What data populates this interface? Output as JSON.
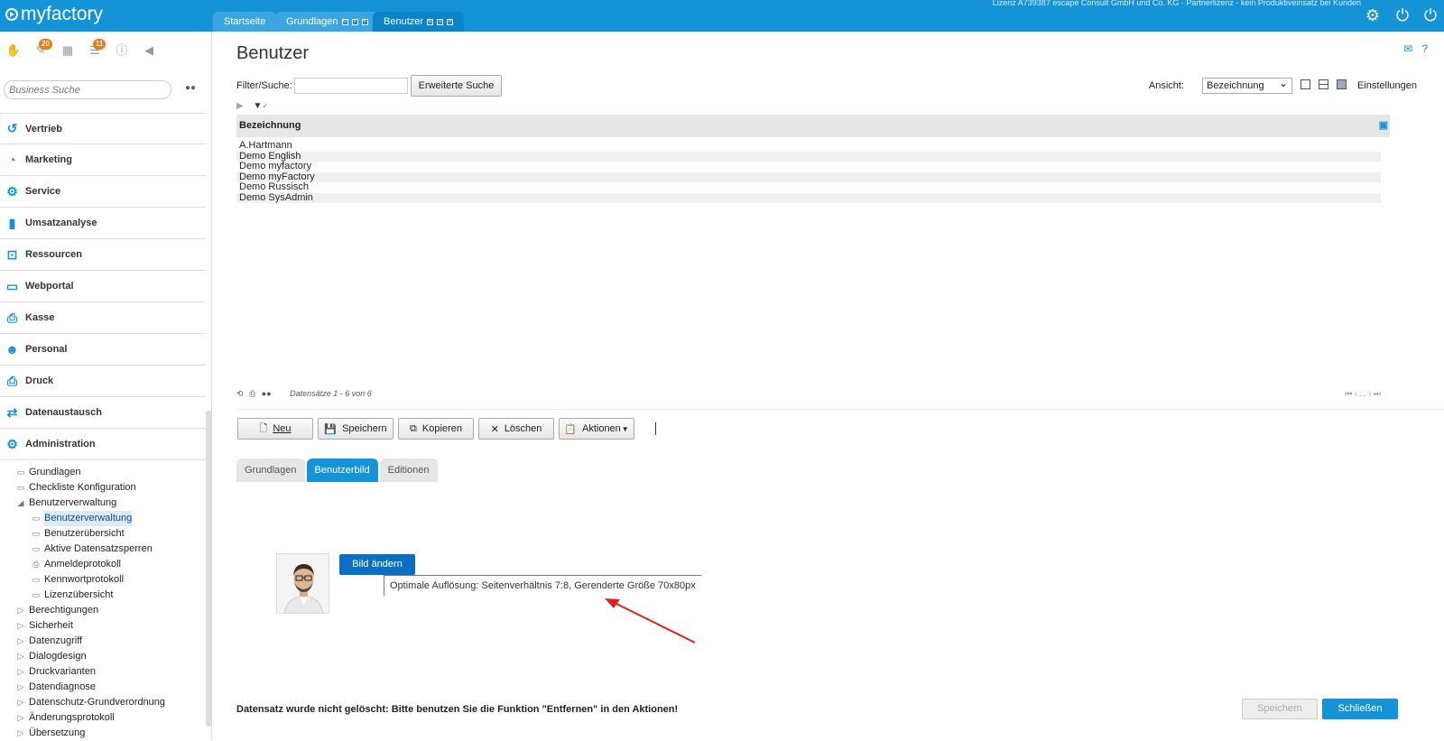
{
  "app": {
    "logo_text": "myfactory",
    "license": "Lizenz A739387 escape Consult GmbH und Co. KG - Partnerlizenz - kein Produktiveinsatz bei Kunden"
  },
  "tabs": [
    {
      "label": "Startseite"
    },
    {
      "label": "Grundlagen"
    },
    {
      "label": "Benutzer"
    }
  ],
  "sidebar": {
    "badges": {
      "tasks": "20",
      "notes": "11"
    },
    "search_placeholder": "Business Suche",
    "modules": [
      {
        "label": "Vertrieb",
        "icon": "vertrieb-icon"
      },
      {
        "label": "Marketing",
        "icon": "marketing-icon"
      },
      {
        "label": "Service",
        "icon": "service-icon"
      },
      {
        "label": "Umsatzanalyse",
        "icon": "chart-icon"
      },
      {
        "label": "Ressourcen",
        "icon": "ressourcen-icon"
      },
      {
        "label": "Webportal",
        "icon": "webportal-icon"
      },
      {
        "label": "Kasse",
        "icon": "kasse-icon"
      },
      {
        "label": "Personal",
        "icon": "personal-icon"
      },
      {
        "label": "Druck",
        "icon": "printer-icon"
      },
      {
        "label": "Datenaustausch",
        "icon": "exchange-icon"
      },
      {
        "label": "Administration",
        "icon": "gear-icon"
      }
    ],
    "tree": [
      {
        "label": "Grundlagen",
        "level": 1,
        "icon": "page"
      },
      {
        "label": "Checkliste Konfiguration",
        "level": 1,
        "icon": "page"
      },
      {
        "label": "Benutzerverwaltung",
        "level": 1,
        "icon": "open"
      },
      {
        "label": "Benutzerverwaltung",
        "level": 2,
        "icon": "page",
        "selected": true
      },
      {
        "label": "Benutzerübersicht",
        "level": 2,
        "icon": "page"
      },
      {
        "label": "Aktive Datensatzsperren",
        "level": 2,
        "icon": "page"
      },
      {
        "label": "Anmeldeprotokoll",
        "level": 2,
        "icon": "print"
      },
      {
        "label": "Kennwortprotokoll",
        "level": 2,
        "icon": "page"
      },
      {
        "label": "Lizenzübersicht",
        "level": 2,
        "icon": "page"
      },
      {
        "label": "Berechtigungen",
        "level": 1,
        "icon": "closed"
      },
      {
        "label": "Sicherheit",
        "level": 1,
        "icon": "closed"
      },
      {
        "label": "Datenzugriff",
        "level": 1,
        "icon": "closed"
      },
      {
        "label": "Dialogdesign",
        "level": 1,
        "icon": "closed"
      },
      {
        "label": "Druckvarianten",
        "level": 1,
        "icon": "closed"
      },
      {
        "label": "Datendiagnose",
        "level": 1,
        "icon": "closed"
      },
      {
        "label": "Datenschutz-Grundverordnung",
        "level": 1,
        "icon": "closed"
      },
      {
        "label": "Änderungsprotokoll",
        "level": 1,
        "icon": "closed"
      },
      {
        "label": "Übersetzung",
        "level": 1,
        "icon": "closed"
      }
    ]
  },
  "page": {
    "title": "Benutzer",
    "filter_label": "Filter/Suche:",
    "filter_value": "",
    "extended_search": "Erweiterte Suche",
    "view_label": "Ansicht:",
    "view_value": "Bezeichnung",
    "settings": "Einstellungen"
  },
  "grid": {
    "header": "Bezeichnung",
    "rows": [
      "A.Hartmann",
      "Demo English",
      "Demo myfactory",
      "Demo myFactory",
      "Demo Russisch",
      "Demo SysAdmin"
    ],
    "record_info": "Datensätze 1 - 6 von 6",
    "pager": "..."
  },
  "actions": {
    "neu": "Neu",
    "speichern": "Speichern",
    "kopieren": "Kopieren",
    "loeschen": "Löschen",
    "aktionen": "Aktionen"
  },
  "detail_tabs": [
    {
      "label": "Grundlagen"
    },
    {
      "label": "Benutzerbild"
    },
    {
      "label": "Editionen"
    }
  ],
  "picture": {
    "change_button": "Bild ändern",
    "hint": "Optimale Auflösung: Seitenverhältnis 7:8, Gerenderte Größe 70x80px"
  },
  "footer": {
    "status": "Datensatz wurde nicht gelöscht: Bitte benutzen Sie die Funktion \"Entfernen\" in den Aktionen!",
    "save": "Speichern",
    "close": "Schließen"
  },
  "colors": {
    "brand": "#1493d6",
    "active_tab": "#0a84c8",
    "badge": "#f07a12",
    "arrow": "#e02020"
  }
}
